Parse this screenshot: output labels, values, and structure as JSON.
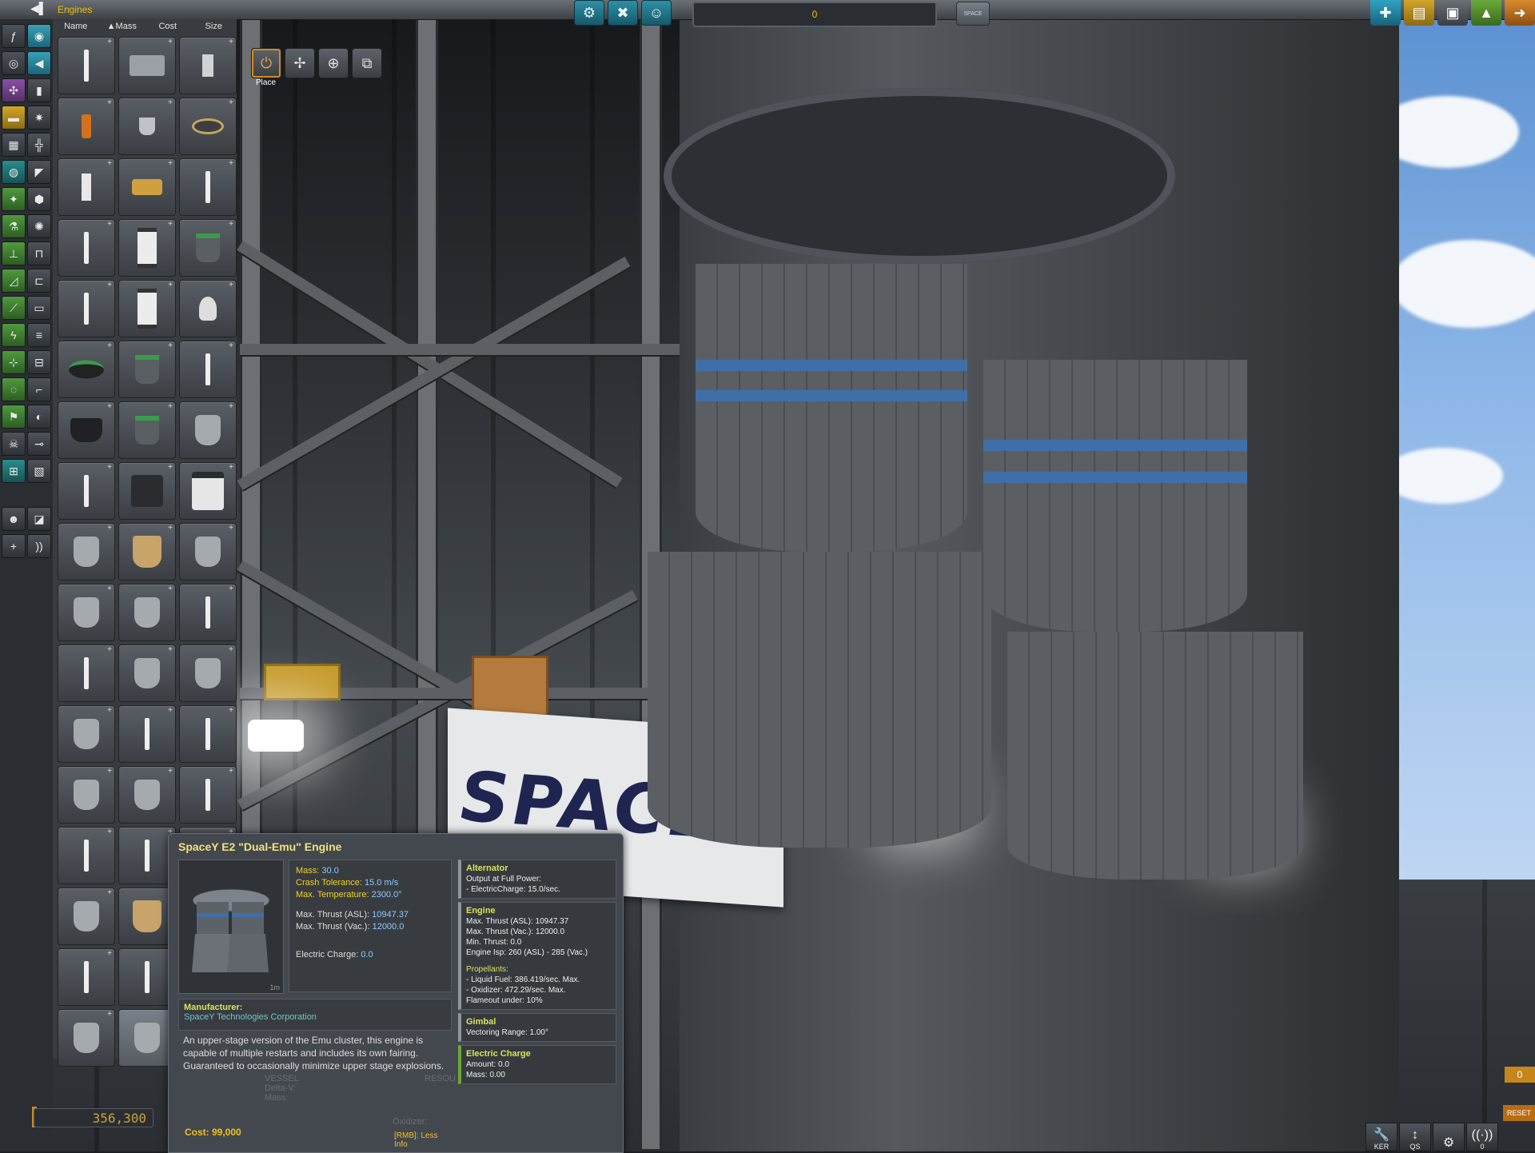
{
  "topbar": {
    "category_title": "Engines",
    "vessel_name": "0",
    "space_label": "SPACE"
  },
  "parts_panel": {
    "sort_headers": [
      "Name",
      "Mass",
      "Cost",
      "Size"
    ],
    "sort_arrow": "▲"
  },
  "tools": {
    "active_label": "Place"
  },
  "funds": "356,300",
  "tooltip": {
    "title": "SpaceY E2 \"Dual-Emu\" Engine",
    "size_tag": "1m",
    "stats": {
      "mass_label": "Mass:",
      "mass_value": "30.0",
      "crash_label": "Crash Tolerance:",
      "crash_value": "15.0 m/s",
      "temp_label": "Max. Temperature:",
      "temp_value": "2300.0°",
      "thrust_asl_label": "Max. Thrust (ASL):",
      "thrust_asl_value": "10947.37",
      "thrust_vac_label": "Max. Thrust (Vac.):",
      "thrust_vac_value": "12000.0",
      "ec_label": "Electric Charge:",
      "ec_value": "0.0"
    },
    "manufacturer_label": "Manufacturer:",
    "manufacturer": "SpaceY Technologies Corporation",
    "description": "An upper-stage version of the Emu cluster, this engine is capable of multiple restarts and includes its own fairing. Guaranteed to occasionally minimize upper stage explosions.",
    "cost": "Cost: 99,000",
    "rmb": "[RMB]: Less Info",
    "modules": [
      {
        "title": "Alternator",
        "lines": [
          "Output at Full Power:",
          "- ElectricCharge: 15.0/sec."
        ]
      },
      {
        "title": "Engine",
        "lines": [
          "Max. Thrust (ASL): 10947.37",
          "Max. Thrust (Vac.): 12000.0",
          "Min. Thrust: 0.0",
          "Engine Isp: 260 (ASL) - 285 (Vac.)",
          "",
          "Propellants:",
          "- Liquid Fuel: 386.419/sec. Max.",
          "- Oxidizer: 472.29/sec. Max.",
          "Flameout under: 10%"
        ]
      },
      {
        "title": "Gimbal",
        "lines": [
          "Vectoring Range: 1.00°"
        ]
      },
      {
        "title": "Electric Charge",
        "lines": [
          "Amount: 0.0",
          "Mass: 0.00"
        ]
      }
    ],
    "background_ghost": [
      "VESSEL",
      "Delta-V:",
      "Mass:",
      "RESOU",
      "Oxidizer:"
    ]
  },
  "banner_text": "SPACEY",
  "bottom_right": {
    "counter": "0",
    "reset": "RESET",
    "buttons": [
      {
        "label": "KER",
        "icon": "wrench-icon"
      },
      {
        "label": "QS",
        "icon": "arrows-icon"
      },
      {
        "label": "",
        "icon": "gear-icon"
      },
      {
        "label": "0",
        "icon": "antenna-icon"
      }
    ]
  },
  "colors": {
    "accent_yellow": "#f0c000",
    "accent_teal": "#2f8fa5",
    "stat_blue": "#8ec8ff"
  }
}
